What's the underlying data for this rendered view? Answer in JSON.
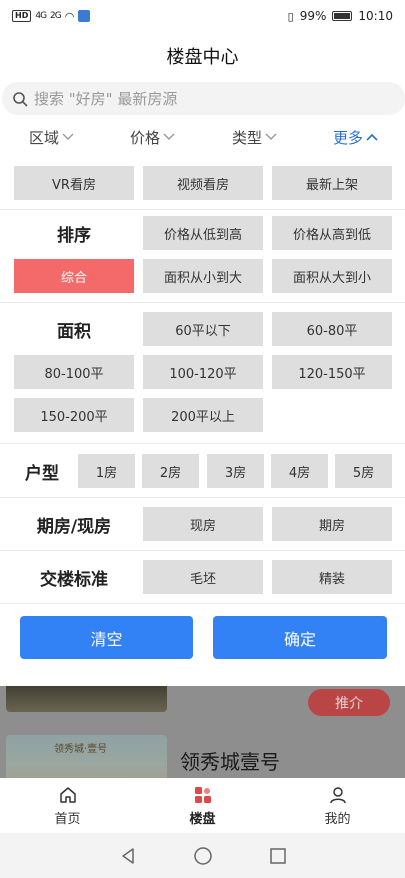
{
  "status_bar": {
    "hd_badge": "HD",
    "signal_1": "4G",
    "signal_2": "2G",
    "battery_percent": "99%",
    "time": "10:10"
  },
  "header": {
    "title": "楼盘中心"
  },
  "search": {
    "placeholder": "搜索 \"好房\" 最新房源"
  },
  "filter_tabs": [
    {
      "label": "区域"
    },
    {
      "label": "价格"
    },
    {
      "label": "类型"
    },
    {
      "label": "更多"
    }
  ],
  "quick_filters": [
    "VR看房",
    "视频看房",
    "最新上架"
  ],
  "sort": {
    "label": "排序",
    "options": [
      "价格从低到高",
      "价格从高到低",
      "综合",
      "面积从小到大",
      "面积从大到小"
    ],
    "selected": "综合"
  },
  "area": {
    "label": "面积",
    "options": [
      "60平以下",
      "60-80平",
      "80-100平",
      "100-120平",
      "120-150平",
      "150-200平",
      "200平以上"
    ]
  },
  "layout_type": {
    "label": "户型",
    "options": [
      "1房",
      "2房",
      "3房",
      "4房",
      "5房"
    ]
  },
  "delivery_state": {
    "label": "期房/现房",
    "options": [
      "现房",
      "期房"
    ]
  },
  "delivery_standard": {
    "label": "交楼标准",
    "options": [
      "毛坯",
      "精装"
    ]
  },
  "actions": {
    "clear": "清空",
    "confirm": "确定"
  },
  "listing": {
    "promo_tag": "推介",
    "logo_text": "领秀城·壹号",
    "title": "领秀城壹号"
  },
  "bottom_nav": [
    {
      "label": "首页",
      "icon": "home-icon"
    },
    {
      "label": "楼盘",
      "icon": "building-icon"
    },
    {
      "label": "我的",
      "icon": "user-icon"
    }
  ],
  "colors": {
    "accent_blue": "#3282f5",
    "selected_red": "#f46a6a",
    "chip_gray": "#dedede",
    "more_blue": "#2a6fd6",
    "nav_active_red": "#e04848"
  }
}
